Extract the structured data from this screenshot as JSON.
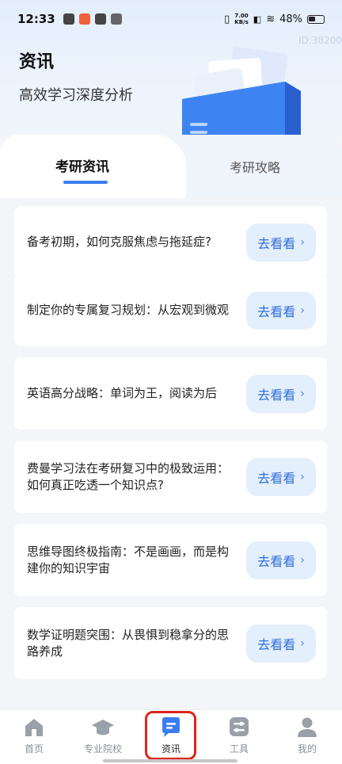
{
  "status_bar": {
    "time": "12:33",
    "net_speed_value": "7.00",
    "net_speed_unit": "KB/s",
    "battery": "48%"
  },
  "watermark": "ID:38200",
  "header": {
    "title": "资讯",
    "subtitle": "高效学习深度分析"
  },
  "tabs": [
    {
      "label": "考研资讯",
      "active": true
    },
    {
      "label": "考研攻略",
      "active": false
    }
  ],
  "articles": [
    {
      "title": "备考初期，如何克服焦虑与拖延症?",
      "button": "去看看"
    },
    {
      "title": "制定你的专属复习规划：从宏观到微观",
      "button": "去看看"
    },
    {
      "title": "英语高分战略：单词为王，阅读为后",
      "button": "去看看"
    },
    {
      "title": "费曼学习法在考研复习中的极致运用：如何真正吃透一个知识点?",
      "button": "去看看"
    },
    {
      "title": "思维导图终极指南：不是画画，而是构建你的知识宇宙",
      "button": "去看看"
    },
    {
      "title": "数学证明题突围：从畏惧到稳拿分的思路养成",
      "button": "去看看"
    }
  ],
  "bottom_nav": [
    {
      "label": "首页",
      "icon": "home-icon"
    },
    {
      "label": "专业院校",
      "icon": "graduation-cap-icon"
    },
    {
      "label": "资讯",
      "icon": "message-icon",
      "active": true
    },
    {
      "label": "工具",
      "icon": "tools-icon"
    },
    {
      "label": "我的",
      "icon": "user-icon"
    }
  ],
  "colors": {
    "accent": "#3a7df0",
    "button_bg": "#e4effc",
    "highlight": "#e0231c"
  }
}
